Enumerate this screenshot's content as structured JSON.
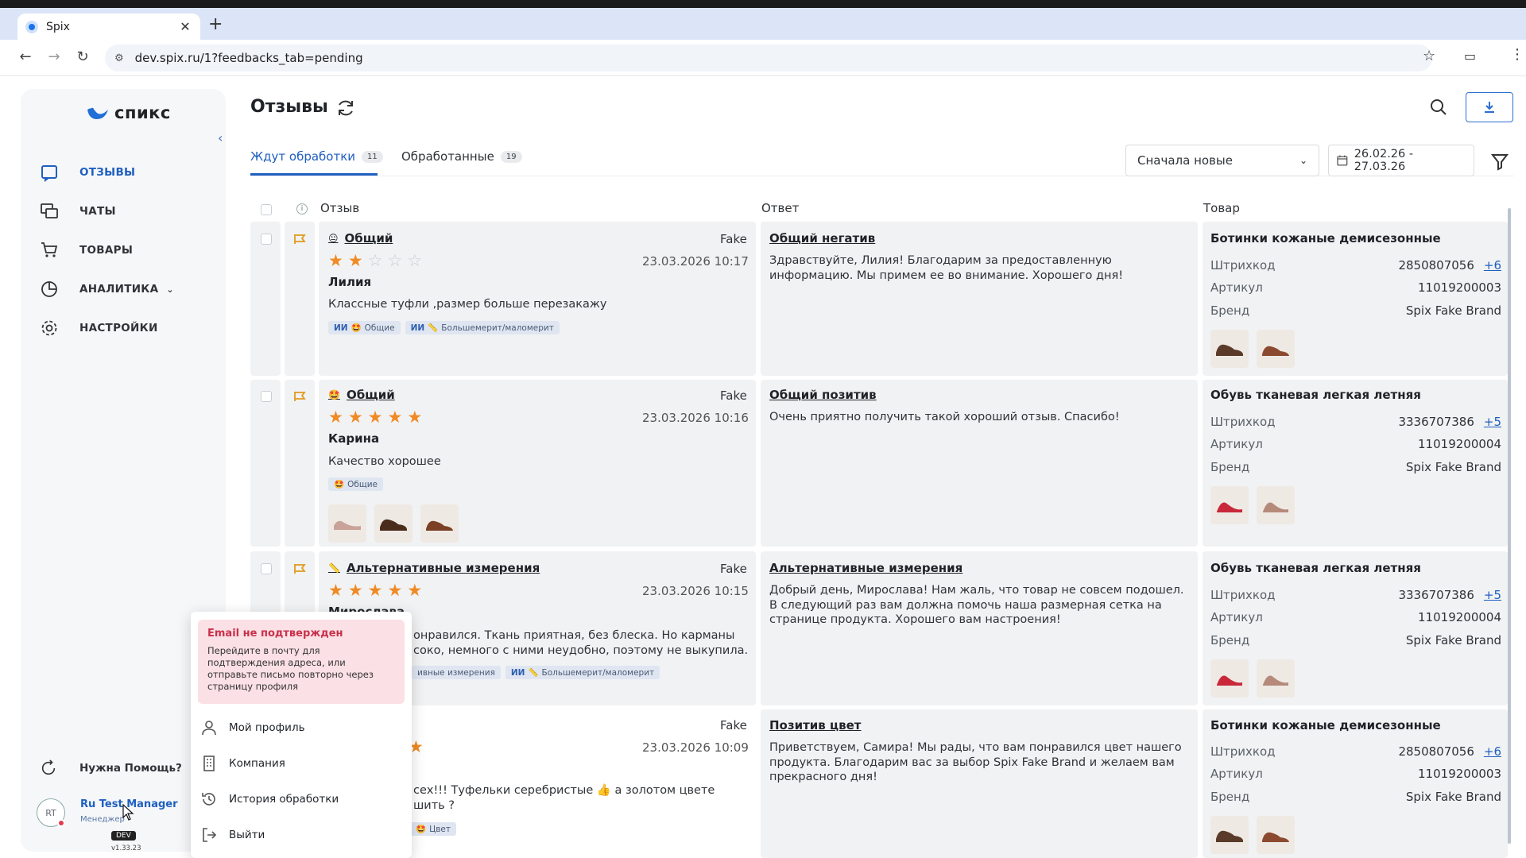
{
  "browser": {
    "tab_title": "Spix",
    "url": "dev.spix.ru/1?feedbacks_tab=pending"
  },
  "sidebar": {
    "logo_text": "спикс",
    "items": [
      {
        "label": "ОТЗЫВЫ",
        "icon": "reviews-icon",
        "active": true
      },
      {
        "label": "ЧАТЫ",
        "icon": "chats-icon"
      },
      {
        "label": "ТОВАРЫ",
        "icon": "cart-icon"
      },
      {
        "label": "АНАЛИТИКА",
        "icon": "analytics-icon"
      },
      {
        "label": "НАСТРОЙКИ",
        "icon": "gear-icon"
      }
    ],
    "help": "Нужна Помощь?",
    "user": {
      "initials": "RT",
      "name": "Ru Test Manager",
      "role": "Менеджер",
      "env": "DEV",
      "version": "v1.33.23"
    }
  },
  "header": {
    "title": "Отзывы"
  },
  "tabs": [
    {
      "label": "Ждут обработки",
      "count": "11"
    },
    {
      "label": "Обработанные",
      "count": "19"
    }
  ],
  "filters": {
    "sort": "Сначала новые",
    "date_range": "26.02.26 - 27.03.26"
  },
  "columns": {
    "review": "Отзыв",
    "answer": "Ответ",
    "product": "Товар"
  },
  "product_labels": {
    "barcode": "Штрихкод",
    "article": "Артикул",
    "brand": "Бренд"
  },
  "rows": [
    {
      "category": "Общий",
      "emoji": "😐",
      "source": "Fake",
      "date": "23.03.2026 10:17",
      "rating": 2,
      "author": "Лилия",
      "text": "Классные туфли ,размер больше перезакажу",
      "tag1_ai": "ИИ",
      "tag1_text": "Общие",
      "tag2_ai": "ИИ",
      "tag2_text": "Большемерит/маломерит",
      "answer_title": "Общий негатив",
      "answer_text": "Здравствуйте, Лилия! Благодарим за предоставленную информацию. Мы примем ее во внимание. Хорошего дня!",
      "product": "Ботинки кожаные демисезонные",
      "barcode": "2850807056",
      "barcode_more": "+6",
      "article": "11019200003",
      "brand": "Spix Fake Brand"
    },
    {
      "category": "Общий",
      "emoji": "🤩",
      "source": "Fake",
      "date": "23.03.2026 10:16",
      "rating": 5,
      "author": "Карина",
      "text": "Качество хорошее",
      "tag1_text": "Общие",
      "answer_title": "Общий позитив",
      "answer_text": "Очень приятно получить такой хороший отзыв. Спасибо!",
      "product": "Обувь тканевая легкая летняя",
      "barcode": "3336707386",
      "barcode_more": "+5",
      "article": "11019200004",
      "brand": "Spix Fake Brand"
    },
    {
      "category": "Альтернативные измерения",
      "emoji": "📏",
      "source": "Fake",
      "date": "23.03.2026 10:15",
      "rating": 5,
      "author": "Мирослава",
      "text_line1": "онравился. Ткань приятная, без блеска. Но карманы",
      "text_line2": "соко, немного с ними неудобно, поэтому не выкупила.",
      "tag1_text": "ивные измерения",
      "tag2_ai": "ИИ",
      "tag2_text": "Большемерит/маломерит",
      "answer_title": "Альтернативные измерения",
      "answer_text": "Добрый день, Мирослава! Нам жаль, что товар не совсем подошел. В следующий раз вам должна помочь наша размерная сетка на странице продукта. Хорошего вам настроения!",
      "product": "Обувь тканевая легкая летняя",
      "barcode": "3336707386",
      "barcode_more": "+5",
      "article": "11019200004",
      "brand": "Spix Fake Brand"
    },
    {
      "source": "Fake",
      "date": "23.03.2026 10:09",
      "rating": 5,
      "text_line1": "сех!!! Туфельки серебристые 👍 а золотом цвете",
      "text_line2": "шить ?",
      "tag1_text": "Цвет",
      "answer_title": "Позитив цвет",
      "answer_text": "Приветствуем, Самира! Мы рады, что вам понравился цвет нашего продукта. Благодарим вас за выбор Spix Fake Brand и желаем вам прекрасного дня!",
      "product": "Ботинки кожаные демисезонные",
      "barcode": "2850807056",
      "barcode_more": "+6",
      "article": "11019200003",
      "brand": "Spix Fake Brand"
    }
  ],
  "popup": {
    "alert_title": "Email не подтвержден",
    "alert_text": "Перейдите в почту для подтверждения адреса, или отправьте письмо повторно через страницу профиля",
    "menu": [
      {
        "label": "Мой профиль",
        "icon": "user-icon"
      },
      {
        "label": "Компания",
        "icon": "building-icon"
      },
      {
        "label": "История обработки",
        "icon": "history-icon"
      },
      {
        "label": "Выйти",
        "icon": "logout-icon"
      }
    ]
  }
}
